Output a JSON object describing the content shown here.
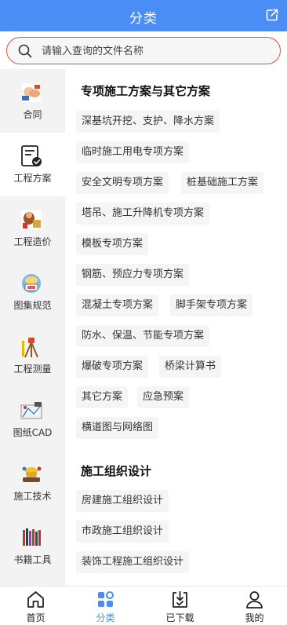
{
  "header": {
    "title": "分类",
    "share_icon": "share-icon"
  },
  "search": {
    "placeholder": "请输入查询的文件名称",
    "value": ""
  },
  "colors": {
    "primary": "#4a8ef5",
    "search_border": "#e4503e"
  },
  "sidebar": {
    "items": [
      {
        "label": "合同",
        "icon": "contract-icon",
        "active": false
      },
      {
        "label": "工程方案",
        "icon": "document-check-icon",
        "active": true
      },
      {
        "label": "工程造价",
        "icon": "cost-icon",
        "active": false
      },
      {
        "label": "图集规范",
        "icon": "atlas-icon",
        "active": false
      },
      {
        "label": "工程测量",
        "icon": "surveying-icon",
        "active": false
      },
      {
        "label": "图纸CAD",
        "icon": "cad-drawing-icon",
        "active": false
      },
      {
        "label": "施工技术",
        "icon": "construction-tech-icon",
        "active": false
      },
      {
        "label": "书籍工具",
        "icon": "books-tools-icon",
        "active": false
      }
    ]
  },
  "content": {
    "sections": [
      {
        "title": "专项施工方案与其它方案",
        "chips": [
          "深基坑开挖、支护、降水方案",
          "临时施工用电专项方案",
          "安全文明专项方案",
          "桩基础施工方案",
          "塔吊、施工升降机专项方案",
          "模板专项方案",
          "钢筋、预应力专项方案",
          "混凝土专项方案",
          "脚手架专项方案",
          "防水、保温、节能专项方案",
          "爆破专项方案",
          "桥梁计算书",
          "其它方案",
          "应急预案",
          "横道图与网络图"
        ]
      },
      {
        "title": "施工组织设计",
        "chips": [
          "房建施工组织设计",
          "市政施工组织设计",
          "装饰工程施工组织设计"
        ]
      }
    ]
  },
  "tabbar": {
    "items": [
      {
        "label": "首页",
        "icon": "home-icon",
        "active": false
      },
      {
        "label": "分类",
        "icon": "category-icon",
        "active": true
      },
      {
        "label": "已下载",
        "icon": "downloaded-icon",
        "active": false
      },
      {
        "label": "我的",
        "icon": "profile-icon",
        "active": false
      }
    ]
  }
}
